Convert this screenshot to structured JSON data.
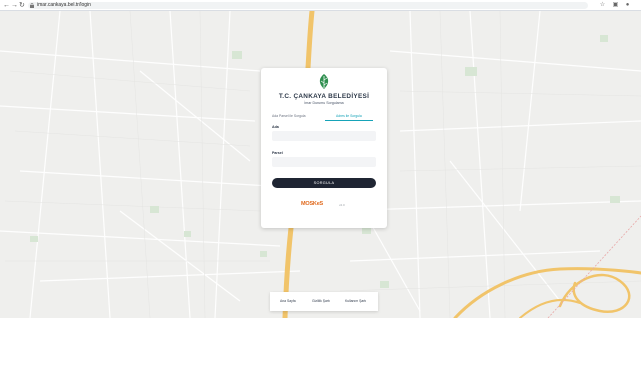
{
  "browser": {
    "url": "imar.cankaya.bel.tr/login",
    "nav": {
      "back": "←",
      "forward": "→",
      "reload": "↻"
    },
    "toolbar_icons": [
      "star-icon",
      "extensions-icon",
      "profile-icon"
    ]
  },
  "login": {
    "title": "T.C. ÇANKAYA BELEDİYESİ",
    "subtitle": "İmar Durumu Sorgulama",
    "tabs": [
      {
        "label": "Ada Parsel ile Sorgula"
      },
      {
        "label": "Adres ile Sorgula"
      }
    ],
    "fields": {
      "ada_label": "Ada",
      "parsel_label": "Parsel"
    },
    "submit_label": "SORGULA",
    "brand": "MOSKeS",
    "brand_sub": "v2.0"
  },
  "footer": {
    "links": [
      "Ana Sayfa",
      "Gizlilik Şartı",
      "Kullanım Şartı"
    ]
  },
  "colors": {
    "accent": "#16a3b8",
    "button": "#1f2533",
    "road": "#f1c46a",
    "brand": "#e06a1e",
    "map_bg": "#efefed"
  }
}
